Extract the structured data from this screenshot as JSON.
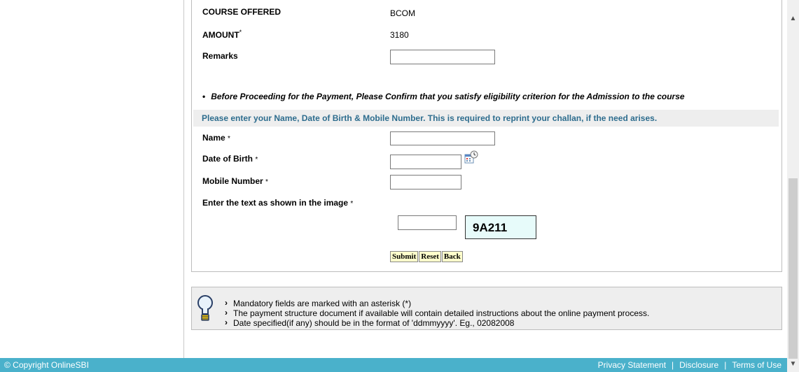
{
  "form": {
    "course_label": "COURSE OFFERED",
    "course_value": "BCOM",
    "amount_label": "AMOUNT",
    "amount_value": "3180",
    "remarks_label": "Remarks",
    "remarks_value": "",
    "eligibility_note": "Before Proceeding for the Payment, Please Confirm that you satisfy eligibility criterion for the Admission to the course",
    "band_text": "Please enter your Name, Date of Birth & Mobile Number. This is required to reprint your challan, if the need arises.",
    "name_label": "Name",
    "name_value": "",
    "dob_label": "Date of Birth",
    "dob_value": "",
    "mobile_label": "Mobile Number",
    "mobile_value": "",
    "captcha_label": "Enter the text as shown in the image",
    "captcha_input_value": "",
    "captcha_text": "9A211",
    "mandatory_mark": "*",
    "bullet": "•"
  },
  "buttons": {
    "submit": "Submit",
    "reset": "Reset",
    "back": "Back"
  },
  "info": {
    "items": [
      "Mandatory fields are marked with an asterisk (*)",
      "The payment structure document if available will contain detailed instructions about the online payment process.",
      "Date specified(if any) should be in the format of 'ddmmyyyy'. Eg., 02082008"
    ]
  },
  "footer": {
    "copyright": "© Copyright OnlineSBI",
    "links": [
      "Privacy Statement",
      "Disclosure",
      "Terms of Use"
    ],
    "separator": "|"
  },
  "colors": {
    "footer_bg": "#4ab1cb",
    "band_text": "#2e6d8e",
    "captcha_bg": "#e7fbfa",
    "button_bg": "#ffffcc"
  },
  "icons": [
    "calendar-icon",
    "lightbulb-icon",
    "scroll-up-icon",
    "scroll-down-icon"
  ]
}
